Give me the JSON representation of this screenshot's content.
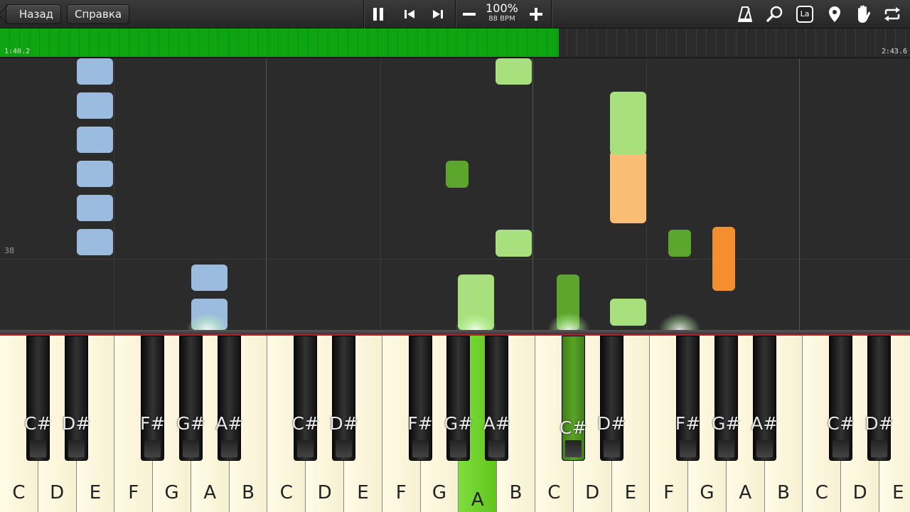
{
  "toolbar": {
    "back_label": "Назад",
    "help_label": "Справка",
    "tempo_percent": "100%",
    "tempo_bpm": "88 BPM",
    "icons": [
      "pause-icon",
      "skip-back-icon",
      "skip-forward-icon",
      "minus-icon",
      "plus-icon",
      "metronome-icon",
      "search-icon",
      "note-label-icon",
      "location-pin-icon",
      "hand-icon",
      "loop-icon"
    ],
    "note_label_badge": "La"
  },
  "progress": {
    "elapsed": "1:40.2",
    "total": "2:43.6",
    "fraction": 0.614,
    "color": "#0fa512"
  },
  "roll": {
    "measure_number": "38",
    "colors": {
      "blue": "#9bbcde",
      "light_green": "#a7e07d",
      "dark_green": "#5da62e",
      "peach": "#f9be73",
      "orange": "#f38f2e"
    }
  },
  "keyboard": {
    "white_keys": [
      "C",
      "D",
      "E",
      "F",
      "G",
      "A",
      "B",
      "C",
      "D",
      "E",
      "F",
      "G",
      "A",
      "B",
      "C",
      "D",
      "E",
      "F",
      "G",
      "A",
      "B",
      "C",
      "D",
      "E"
    ],
    "black_keys": [
      "C#",
      "D#",
      "F#",
      "G#",
      "A#",
      "C#",
      "D#",
      "F#",
      "G#",
      "A#",
      "C#",
      "D#",
      "F#",
      "G#",
      "A#",
      "C#",
      "D#"
    ],
    "pressed_white_index": 12,
    "pressed_black_index": 10,
    "highlight_color": "#7fde3c"
  }
}
